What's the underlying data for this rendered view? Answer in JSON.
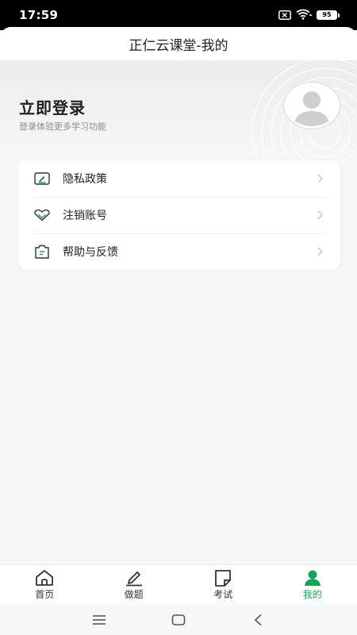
{
  "status_bar": {
    "time": "17:59",
    "battery_level": "95",
    "icons": [
      "sim-no-signal-icon",
      "wifi-icon",
      "battery-icon"
    ]
  },
  "nav_bar": {
    "title": "正仁云课堂-我的"
  },
  "profile": {
    "login_title": "立即登录",
    "login_subtitle": "登录体验更多学习功能"
  },
  "menu": {
    "items": [
      {
        "label": "隐私政策",
        "icon": "privacy-policy-icon"
      },
      {
        "label": "注销账号",
        "icon": "cancel-account-icon"
      },
      {
        "label": "帮助与反馈",
        "icon": "help-feedback-icon"
      }
    ]
  },
  "tab_bar": {
    "tabs": [
      {
        "label": "首页",
        "icon": "home-icon"
      },
      {
        "label": "做题",
        "icon": "pencil-icon"
      },
      {
        "label": "考试",
        "icon": "exam-note-icon"
      },
      {
        "label": "我的",
        "icon": "person-icon",
        "active": true
      }
    ]
  },
  "colors": {
    "accent": "#1aa35a",
    "icon_teal": "#2b8a6e"
  },
  "system_nav": [
    "menu-icon",
    "home-square-icon",
    "back-icon"
  ]
}
